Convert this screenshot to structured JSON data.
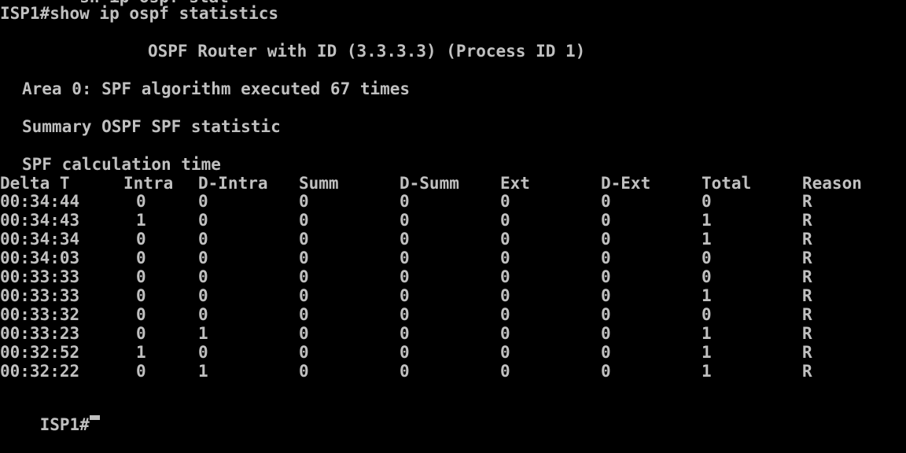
{
  "terminal": {
    "prev_command_partial": "        sh ip ospf stat",
    "command_line": "ISP1#show ip ospf statistics",
    "router_header": "OSPF Router with ID (3.3.3.3) (Process ID 1)",
    "area_line": "Area 0: SPF algorithm executed 67 times",
    "summary_line": "Summary OSPF SPF statistic",
    "calc_title": "SPF calculation time",
    "columns": [
      "Delta T",
      "Intra",
      "D-Intra",
      "Summ",
      "D-Summ",
      "Ext",
      "D-Ext",
      "Total",
      "Reason"
    ],
    "rows": [
      [
        "00:34:44",
        "0",
        "0",
        "0",
        "0",
        "0",
        "0",
        "0",
        "R"
      ],
      [
        "00:34:43",
        "1",
        "0",
        "0",
        "0",
        "0",
        "0",
        "1",
        "R"
      ],
      [
        "00:34:34",
        "0",
        "0",
        "0",
        "0",
        "0",
        "0",
        "1",
        "R"
      ],
      [
        "00:34:03",
        "0",
        "0",
        "0",
        "0",
        "0",
        "0",
        "0",
        "R"
      ],
      [
        "00:33:33",
        "0",
        "0",
        "0",
        "0",
        "0",
        "0",
        "0",
        "R"
      ],
      [
        "00:33:33",
        "0",
        "0",
        "0",
        "0",
        "0",
        "0",
        "1",
        "R"
      ],
      [
        "00:33:32",
        "0",
        "0",
        "0",
        "0",
        "0",
        "0",
        "0",
        "R"
      ],
      [
        "00:33:23",
        "0",
        "1",
        "0",
        "0",
        "0",
        "0",
        "1",
        "R"
      ],
      [
        "00:32:52",
        "1",
        "0",
        "0",
        "0",
        "0",
        "0",
        "1",
        "R"
      ],
      [
        "00:32:22",
        "0",
        "1",
        "0",
        "0",
        "0",
        "0",
        "1",
        "R"
      ]
    ],
    "prompt": "ISP1#",
    "colors": {
      "background": "#000000",
      "foreground": "#c0c0c0"
    }
  }
}
